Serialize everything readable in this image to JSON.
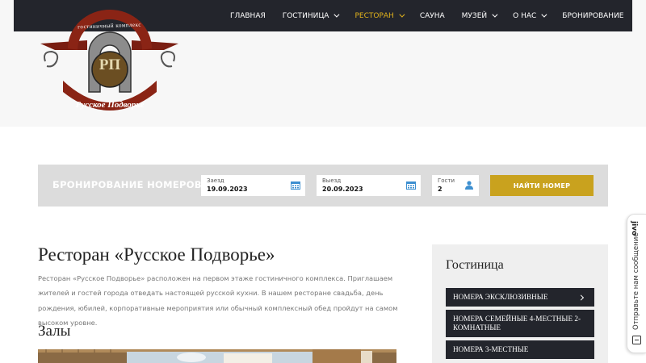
{
  "nav": {
    "items": [
      {
        "label": "ГЛАВНАЯ",
        "dropdown": false,
        "active": false
      },
      {
        "label": "ГОСТИНИЦА",
        "dropdown": true,
        "active": false
      },
      {
        "label": "РЕСТОРАН",
        "dropdown": true,
        "active": true
      },
      {
        "label": "САУНА",
        "dropdown": false,
        "active": false
      },
      {
        "label": "МУЗЕЙ",
        "dropdown": true,
        "active": false
      },
      {
        "label": "О НАС",
        "dropdown": true,
        "active": false
      },
      {
        "label": "БРОНИРОВАНИЕ",
        "dropdown": false,
        "active": false
      }
    ],
    "active_color": "#e0b21c"
  },
  "logo": {
    "arc_text": "гостиничный комплекс",
    "monogram": "РП",
    "bottom_text": "Русское Подворье"
  },
  "booking": {
    "title": "БРОНИРОВАНИЕ НОМЕРОВ",
    "checkin_label": "Заезд",
    "checkin_value": "19.09.2023",
    "checkout_label": "Выезд",
    "checkout_value": "20.09.2023",
    "guests_label": "Гости",
    "guests_value": "2",
    "submit_label": "НАЙТИ НОМЕР",
    "accent": "#c9a21e"
  },
  "main": {
    "title": "Ресторан «Русское Подворье»",
    "intro": "Ресторан «Русское Подворье» расположен на первом этаже гостиничного комплекса. Приглашаем жителей и гостей города отведать настоящей русской кухни. В нашем ресторане свадьба, день рождения, юбилей, корпоративные мероприятия или обычный комплексный обед пройдут на самом высоком уровне.",
    "halls_title": "Залы"
  },
  "sidebar": {
    "title": "Гостиница",
    "items": [
      {
        "label": "НОМЕРА ЭКСКЛЮЗИВНЫЕ"
      },
      {
        "label": "НОМЕРА СЕМЕЙНЫЕ 4-МЕСТНЫЕ 2-КОМНАТНЫЕ"
      },
      {
        "label": "НОМЕРА 3-МЕСТНЫЕ"
      }
    ]
  },
  "jivo": {
    "logo": "jivo",
    "text": "Отправьте нам сообщение"
  }
}
